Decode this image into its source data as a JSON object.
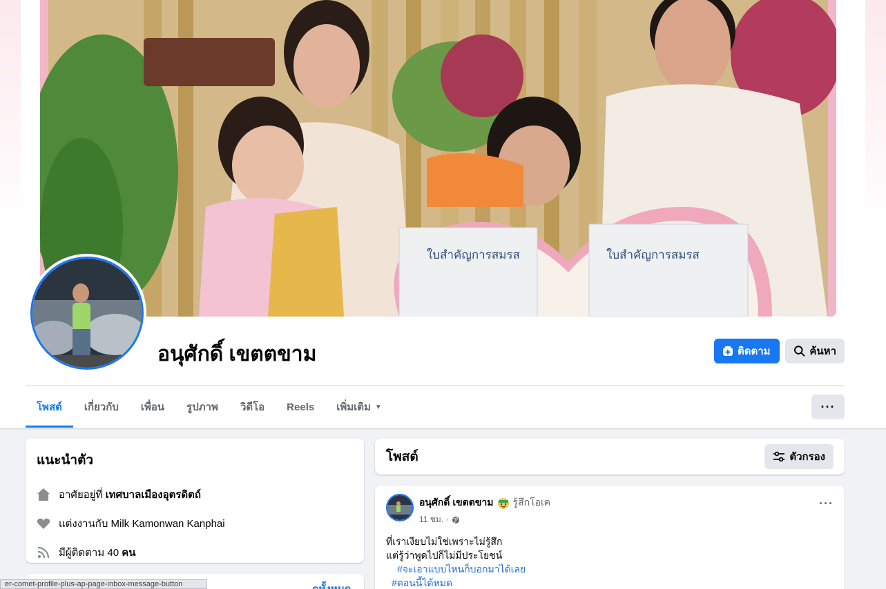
{
  "profile": {
    "name": "อนุศักดิ์ เขตตขาม",
    "follow_label": "ติดตาม",
    "search_label": "ค้นหา",
    "cover_certificate_text": "ใบสำคัญการสมรส"
  },
  "tabs": [
    {
      "label": "โพสต์",
      "active": true
    },
    {
      "label": "เกี่ยวกับ",
      "active": false
    },
    {
      "label": "เพื่อน",
      "active": false
    },
    {
      "label": "รูปภาพ",
      "active": false
    },
    {
      "label": "วิดีโอ",
      "active": false
    },
    {
      "label": "Reels",
      "active": false
    },
    {
      "label": "เพิ่มเติม",
      "active": false
    }
  ],
  "more_button": "···",
  "intro": {
    "title": "แนะนำตัว",
    "lives_prefix": "อาศัยอยู่ที่",
    "lives_place": "เทศบาลเมืองอุตรดิตถ์",
    "married_prefix": "แต่งงานกับ",
    "married_to": "Milk Kamonwan Kanphai",
    "followers_prefix": "มีผู้ติดตาม",
    "followers_count": "40",
    "followers_suffix": "คน"
  },
  "tooltip": "er-comet-profile-plus-ap-page-inbox-message-button",
  "second_card_text": "ดูทั้งหมด",
  "posts": {
    "title": "โพสต์",
    "filter_label": "ตัวกรอง"
  },
  "post": {
    "author": "อนุศักดิ์ เขตตขาม",
    "feeling": "รู้สึกโอเค",
    "time": "11 ชม. ·",
    "lines": [
      "ที่เราเงียบไม่ใช่เพราะไม่รู้สึก",
      "แต่รู้ว่าพูดไปก็ไม่มีประโยชน์"
    ],
    "hashtags": [
      "#จะเอาแบบไหนก็บอกมาได้เลย",
      "#ตอนนี้ได้หมด"
    ]
  },
  "colors": {
    "accent": "#1877f2",
    "background": "#f0f2f5",
    "button_gray": "#e4e6eb"
  }
}
